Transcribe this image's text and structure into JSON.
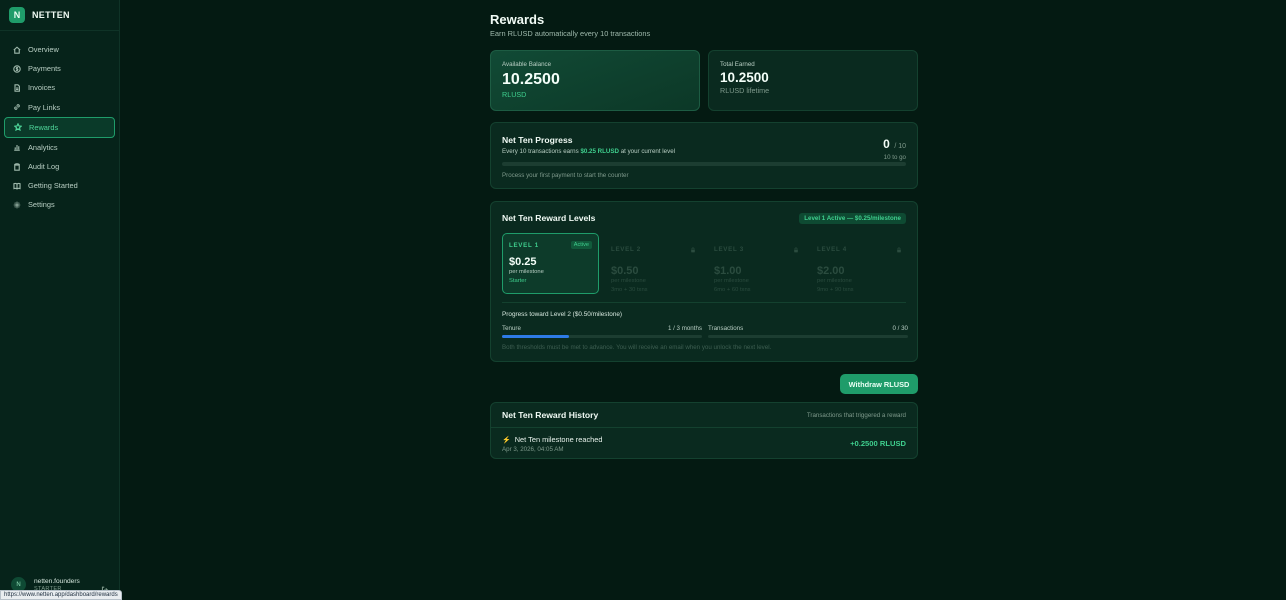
{
  "brand": {
    "logo_letter": "N",
    "name": "NETTEN"
  },
  "sidebar": {
    "items": [
      {
        "label": "Overview",
        "icon": "home-icon"
      },
      {
        "label": "Payments",
        "icon": "dollar-circle-icon"
      },
      {
        "label": "Invoices",
        "icon": "document-icon"
      },
      {
        "label": "Pay Links",
        "icon": "link-icon"
      },
      {
        "label": "Rewards",
        "icon": "star-icon",
        "active": true
      },
      {
        "label": "Analytics",
        "icon": "bar-chart-icon"
      },
      {
        "label": "Audit Log",
        "icon": "clipboard-icon"
      },
      {
        "label": "Getting Started",
        "icon": "book-icon"
      },
      {
        "label": "Settings",
        "icon": "gear-icon"
      }
    ]
  },
  "user": {
    "avatar_letter": "N",
    "name": "netten.founders",
    "plan": "STARTER"
  },
  "status_url": "https://www.netten.app/dashboard/rewards",
  "page": {
    "title": "Rewards",
    "subtitle": "Earn RLUSD automatically every 10 transactions"
  },
  "balance": {
    "label": "Available Balance",
    "value": "10.2500",
    "unit": "RLUSD"
  },
  "earned": {
    "label": "Total Earned",
    "value": "10.2500",
    "unit": "RLUSD lifetime"
  },
  "progress": {
    "title": "Net Ten Progress",
    "desc_prefix": "Every 10 transactions earns",
    "desc_amount": "$0.25 RLUSD",
    "desc_suffix": "at your current level",
    "count": "0",
    "total": "/ 10",
    "to_go": "10 to go",
    "fraction": 0,
    "footer": "Process your first payment to start the counter"
  },
  "levels": {
    "title": "Net Ten Reward Levels",
    "badge": "Level 1 Active — $0.25/milestone",
    "items": [
      {
        "name": "LEVEL 1",
        "amount": "$0.25",
        "per": "per milestone",
        "tier": "Starter",
        "active": true,
        "active_label": "Active"
      },
      {
        "name": "LEVEL 2",
        "amount": "$0.50",
        "per": "per milestone",
        "tier": "3mo + 30 txns",
        "active": false
      },
      {
        "name": "LEVEL 3",
        "amount": "$1.00",
        "per": "per milestone",
        "tier": "6mo + 60 txns",
        "active": false
      },
      {
        "name": "LEVEL 4",
        "amount": "$2.00",
        "per": "per milestone",
        "tier": "9mo + 90 txns",
        "active": false
      }
    ],
    "toward": "Progress toward Level 2 ($0.50/milestone)",
    "tenure": {
      "label": "Tenure",
      "value": "1 / 3 months",
      "fraction": 0.333
    },
    "transactions": {
      "label": "Transactions",
      "value": "0 / 30",
      "fraction": 0
    },
    "note": "Both thresholds must be met to advance. You will receive an email when you unlock the next level."
  },
  "withdraw_label": "Withdraw RLUSD",
  "history": {
    "title": "Net Ten Reward History",
    "subtitle": "Transactions that triggered a reward",
    "rows": [
      {
        "title": "Net Ten milestone reached",
        "date": "Apr 3, 2026, 04:05 AM",
        "amount": "+0.2500 RLUSD"
      }
    ]
  },
  "colors": {
    "accent": "#3fcf8e",
    "button": "#1f9c6a",
    "background": "#041a12",
    "tenure_bar": "#2e7be6"
  }
}
